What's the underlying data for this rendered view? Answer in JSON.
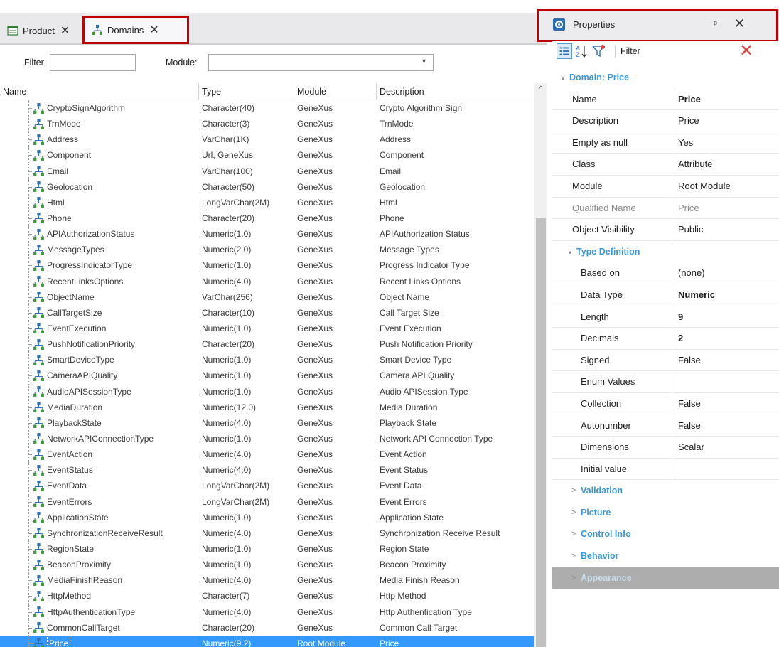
{
  "tabs": [
    {
      "label": "Product",
      "close": "✕"
    },
    {
      "label": "Domains",
      "close": "✕"
    }
  ],
  "filterbar": {
    "filter_label": "Filter:",
    "filter_value": "",
    "module_label": "Module:",
    "module_value": "",
    "caret": "▾"
  },
  "grid": {
    "columns": [
      "Name",
      "Type",
      "Module",
      "Description"
    ],
    "rows": [
      {
        "name": "CryptoSignAlgorithm",
        "type": "Character(40)",
        "module": "GeneXus",
        "description": "Crypto Algorithm Sign"
      },
      {
        "name": "TrnMode",
        "type": "Character(3)",
        "module": "GeneXus",
        "description": "TrnMode"
      },
      {
        "name": "Address",
        "type": "VarChar(1K)",
        "module": "GeneXus",
        "description": "Address"
      },
      {
        "name": "Component",
        "type": "Url, GeneXus",
        "module": "GeneXus",
        "description": "Component"
      },
      {
        "name": "Email",
        "type": "VarChar(100)",
        "module": "GeneXus",
        "description": "Email"
      },
      {
        "name": "Geolocation",
        "type": "Character(50)",
        "module": "GeneXus",
        "description": "Geolocation"
      },
      {
        "name": "Html",
        "type": "LongVarChar(2M)",
        "module": "GeneXus",
        "description": "Html"
      },
      {
        "name": "Phone",
        "type": "Character(20)",
        "module": "GeneXus",
        "description": "Phone"
      },
      {
        "name": "APIAuthorizationStatus",
        "type": "Numeric(1.0)",
        "module": "GeneXus",
        "description": "APIAuthorization Status"
      },
      {
        "name": "MessageTypes",
        "type": "Numeric(2.0)",
        "module": "GeneXus",
        "description": "Message Types"
      },
      {
        "name": "ProgressIndicatorType",
        "type": "Numeric(1.0)",
        "module": "GeneXus",
        "description": "Progress Indicator Type"
      },
      {
        "name": "RecentLinksOptions",
        "type": "Numeric(4.0)",
        "module": "GeneXus",
        "description": "Recent Links Options"
      },
      {
        "name": "ObjectName",
        "type": "VarChar(256)",
        "module": "GeneXus",
        "description": "Object Name"
      },
      {
        "name": "CallTargetSize",
        "type": "Character(10)",
        "module": "GeneXus",
        "description": "Call Target Size"
      },
      {
        "name": "EventExecution",
        "type": "Numeric(1.0)",
        "module": "GeneXus",
        "description": "Event Execution"
      },
      {
        "name": "PushNotificationPriority",
        "type": "Character(20)",
        "module": "GeneXus",
        "description": "Push Notification Priority"
      },
      {
        "name": "SmartDeviceType",
        "type": "Numeric(1.0)",
        "module": "GeneXus",
        "description": "Smart Device Type"
      },
      {
        "name": "CameraAPIQuality",
        "type": "Numeric(1.0)",
        "module": "GeneXus",
        "description": "Camera API Quality"
      },
      {
        "name": "AudioAPISessionType",
        "type": "Numeric(1.0)",
        "module": "GeneXus",
        "description": "Audio APISession Type"
      },
      {
        "name": "MediaDuration",
        "type": "Numeric(12.0)",
        "module": "GeneXus",
        "description": "Media Duration"
      },
      {
        "name": "PlaybackState",
        "type": "Numeric(4.0)",
        "module": "GeneXus",
        "description": "Playback State"
      },
      {
        "name": "NetworkAPIConnectionType",
        "type": "Numeric(1.0)",
        "module": "GeneXus",
        "description": "Network API Connection Type"
      },
      {
        "name": "EventAction",
        "type": "Numeric(4.0)",
        "module": "GeneXus",
        "description": "Event Action"
      },
      {
        "name": "EventStatus",
        "type": "Numeric(4.0)",
        "module": "GeneXus",
        "description": "Event Status"
      },
      {
        "name": "EventData",
        "type": "LongVarChar(2M)",
        "module": "GeneXus",
        "description": "Event Data"
      },
      {
        "name": "EventErrors",
        "type": "LongVarChar(2M)",
        "module": "GeneXus",
        "description": "Event Errors"
      },
      {
        "name": "ApplicationState",
        "type": "Numeric(1.0)",
        "module": "GeneXus",
        "description": "Application State"
      },
      {
        "name": "SynchronizationReceiveResult",
        "type": "Numeric(4.0)",
        "module": "GeneXus",
        "description": "Synchronization Receive Result"
      },
      {
        "name": "RegionState",
        "type": "Numeric(1.0)",
        "module": "GeneXus",
        "description": "Region State"
      },
      {
        "name": "BeaconProximity",
        "type": "Numeric(1.0)",
        "module": "GeneXus",
        "description": "Beacon Proximity"
      },
      {
        "name": "MediaFinishReason",
        "type": "Numeric(4.0)",
        "module": "GeneXus",
        "description": "Media Finish Reason"
      },
      {
        "name": "HttpMethod",
        "type": "Character(7)",
        "module": "GeneXus",
        "description": "Http Method"
      },
      {
        "name": "HttpAuthenticationType",
        "type": "Numeric(4.0)",
        "module": "GeneXus",
        "description": "Http Authentication Type"
      },
      {
        "name": "CommonCallTarget",
        "type": "Character(20)",
        "module": "GeneXus",
        "description": "Common Call Target"
      },
      {
        "name": "Price",
        "type": "Numeric(9.2)",
        "module": "Root Module",
        "description": "Price",
        "selected": true
      }
    ]
  },
  "properties": {
    "title": "Properties",
    "pin": "ᵖ",
    "close": "✕",
    "filter_label": "Filter",
    "clear": "✕",
    "items": [
      {
        "kind": "cat",
        "chev": "∨",
        "title": "Domain: Price"
      },
      {
        "kind": "prop",
        "name": "Name",
        "value": "Price",
        "bold": true
      },
      {
        "kind": "prop",
        "name": "Description",
        "value": "Price"
      },
      {
        "kind": "prop",
        "name": "Empty as null",
        "value": "Yes"
      },
      {
        "kind": "prop",
        "name": "Class",
        "value": "Attribute"
      },
      {
        "kind": "prop",
        "name": "Module",
        "value": "Root Module"
      },
      {
        "kind": "prop",
        "name": "Qualified Name",
        "value": "Price",
        "muted": true
      },
      {
        "kind": "prop",
        "name": "Object Visibility",
        "value": "Public"
      },
      {
        "kind": "subcat",
        "chev": "∨",
        "title": "Type Definition"
      },
      {
        "kind": "subprop",
        "name": "Based on",
        "value": "(none)"
      },
      {
        "kind": "subprop",
        "name": "Data Type",
        "value": "Numeric",
        "bold": true
      },
      {
        "kind": "subprop",
        "name": "Length",
        "value": "9",
        "bold": true
      },
      {
        "kind": "subprop",
        "name": "Decimals",
        "value": "2",
        "bold": true
      },
      {
        "kind": "subprop",
        "name": "Signed",
        "value": "False"
      },
      {
        "kind": "subprop",
        "name": "Enum Values",
        "value": ""
      },
      {
        "kind": "subprop",
        "name": "Collection",
        "value": "False"
      },
      {
        "kind": "subprop",
        "name": "Autonumber",
        "value": "False"
      },
      {
        "kind": "subprop",
        "name": "Dimensions",
        "value": "Scalar"
      },
      {
        "kind": "subprop",
        "name": "Initial value",
        "value": ""
      },
      {
        "kind": "collapsed",
        "chev": ">",
        "title": "Validation"
      },
      {
        "kind": "collapsed",
        "chev": ">",
        "title": "Picture"
      },
      {
        "kind": "collapsed",
        "chev": ">",
        "title": "Control Info"
      },
      {
        "kind": "collapsed",
        "chev": ">",
        "title": "Behavior"
      },
      {
        "kind": "collapsed",
        "chev": ">",
        "title": "Appearance",
        "hilite": true
      }
    ]
  },
  "colors": {
    "highlight_frame": "#c00000",
    "selection": "#3399ff",
    "category": "#3c97d6"
  }
}
